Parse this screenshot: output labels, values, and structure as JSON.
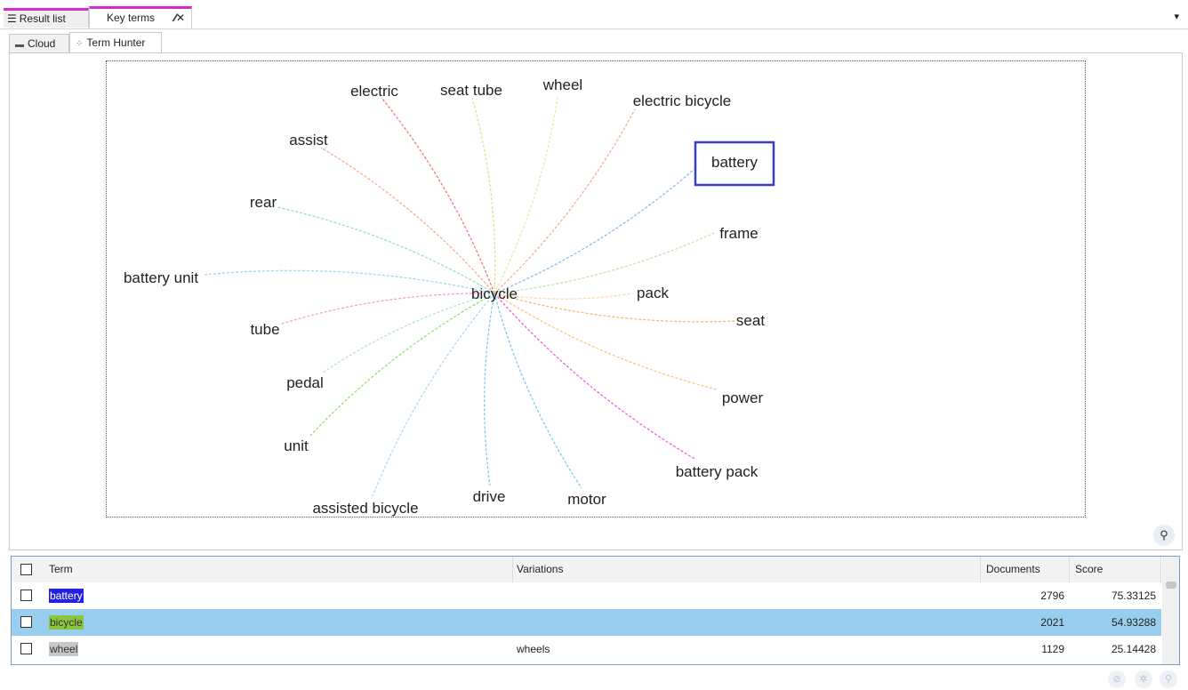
{
  "doc_tabs": [
    {
      "label": "Result list",
      "icon": "list-icon"
    },
    {
      "label": "Key terms",
      "icon": "pin-close-icon"
    }
  ],
  "sub_tabs": [
    {
      "label": "Cloud",
      "icon": "cloud-icon"
    },
    {
      "label": "Term Hunter",
      "icon": "term-hunter-icon"
    }
  ],
  "graph": {
    "center": "bicycle",
    "selected": "battery",
    "highlight_color": "#3a3ec9",
    "terms": [
      {
        "label": "electric",
        "color": "#f0706a"
      },
      {
        "label": "seat tube",
        "color": "#d9e37a"
      },
      {
        "label": "wheel",
        "color": "#e5ea9a"
      },
      {
        "label": "electric bicycle",
        "color": "#f6a784"
      },
      {
        "label": "battery",
        "color": "#7ab8ea"
      },
      {
        "label": "assist",
        "color": "#f5a583"
      },
      {
        "label": "frame",
        "color": "#b8e3a6"
      },
      {
        "label": "rear",
        "color": "#84e0c4"
      },
      {
        "label": "battery unit",
        "color": "#96d6ef"
      },
      {
        "label": "pack",
        "color": "#f7d3a6"
      },
      {
        "label": "seat",
        "color": "#f5b56a"
      },
      {
        "label": "tube",
        "color": "#f29bd8"
      },
      {
        "label": "pedal",
        "color": "#a9e6c9"
      },
      {
        "label": "power",
        "color": "#f5c375"
      },
      {
        "label": "unit",
        "color": "#88dc6c"
      },
      {
        "label": "battery pack",
        "color": "#ee55de"
      },
      {
        "label": "assisted bicycle",
        "color": "#a7d4f3"
      },
      {
        "label": "drive",
        "color": "#75c4ee"
      },
      {
        "label": "motor",
        "color": "#6ec8ea"
      }
    ]
  },
  "table": {
    "headers": {
      "term": "Term",
      "variations": "Variations",
      "documents": "Documents",
      "score": "Score"
    },
    "rows": [
      {
        "term": "battery",
        "variations": "",
        "documents": "2796",
        "score": "75.33125"
      },
      {
        "term": "bicycle",
        "variations": "",
        "documents": "2021",
        "score": "54.93288"
      },
      {
        "term": "wheel",
        "variations": "wheels",
        "documents": "1129",
        "score": "25.14428"
      }
    ]
  }
}
